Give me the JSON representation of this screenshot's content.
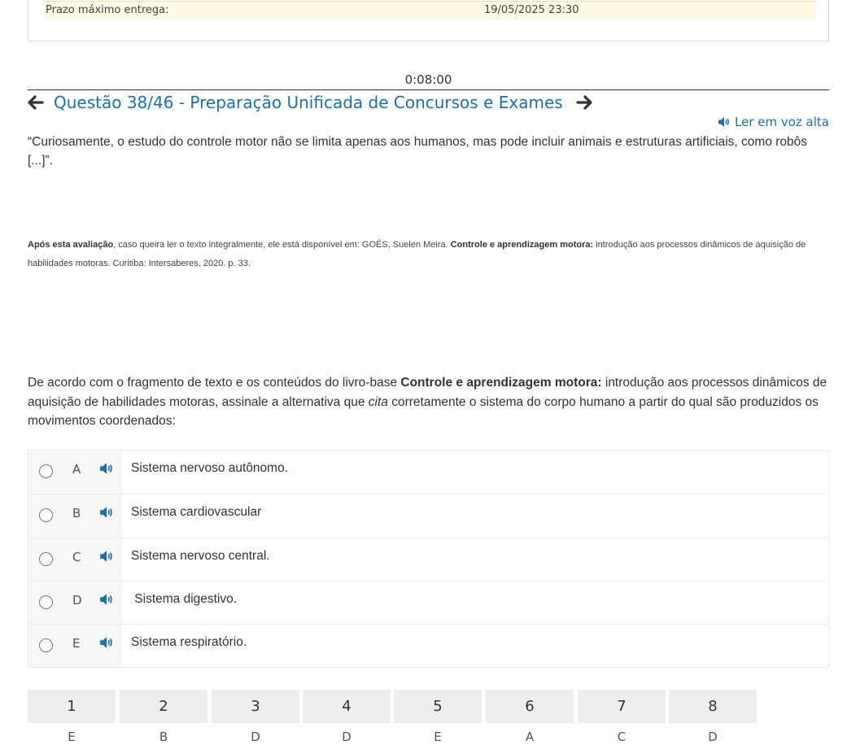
{
  "deadline": {
    "label": "Prazo máximo entrega:",
    "value": "19/05/2025 23:30"
  },
  "timer": "0:08:00",
  "question_title": "Questão 38/46 - Preparação Unificada de Concursos e Exames",
  "read_aloud_label": "Ler em voz alta",
  "quote": " “Curiosamente, o estudo do controle motor não se limita apenas aos humanos, mas pode incluir animais e estruturas artificiais, como robôs [...]”.",
  "source": {
    "bold1": "Após esta avaliação",
    "text1": ", caso queira ler o texto integralmente, ele está disponível em: GOÉS, Suelen Meira. ",
    "bold2": "Controle e aprendizagem motora:",
    "text2": " introdução aos processos dinâmicos de aquisição de habilidades motoras. Curitiba: Intersaberes, 2020. p. 33."
  },
  "question": {
    "part1": "De acordo com o fragmento de texto e os conteúdos do livro-base ",
    "bold": "Controle e aprendizagem motora:",
    "part2": " introdução aos processos dinâmicos de aquisição de habilidades motoras, assinale a alternativa que ",
    "italic": "cita",
    "part3": " corretamente o sistema do corpo humano a partir do qual são produzidos os movimentos coordenados:"
  },
  "options": [
    {
      "letter": "A",
      "text": "Sistema nervoso autônomo."
    },
    {
      "letter": "B",
      "text": "Sistema cardiovascular"
    },
    {
      "letter": "C",
      "text": "Sistema nervoso central."
    },
    {
      "letter": "D",
      "text": " Sistema digestivo."
    },
    {
      "letter": "E",
      "text": "Sistema respiratório."
    }
  ],
  "nav": [
    {
      "num": "1",
      "answer": "E"
    },
    {
      "num": "2",
      "answer": "B"
    },
    {
      "num": "3",
      "answer": "D"
    },
    {
      "num": "4",
      "answer": "D"
    },
    {
      "num": "5",
      "answer": "E"
    },
    {
      "num": "6",
      "answer": "A"
    },
    {
      "num": "7",
      "answer": "C"
    },
    {
      "num": "8",
      "answer": "D"
    }
  ],
  "colors": {
    "accent": "#1f6fa5",
    "deadline_bg": "#fcf8e3",
    "option_bg": "#f7f7f7",
    "nav_bg": "#eeeeee"
  },
  "icons": {
    "prev": "arrow-left-icon",
    "next": "arrow-right-icon",
    "speaker": "volume-icon"
  }
}
